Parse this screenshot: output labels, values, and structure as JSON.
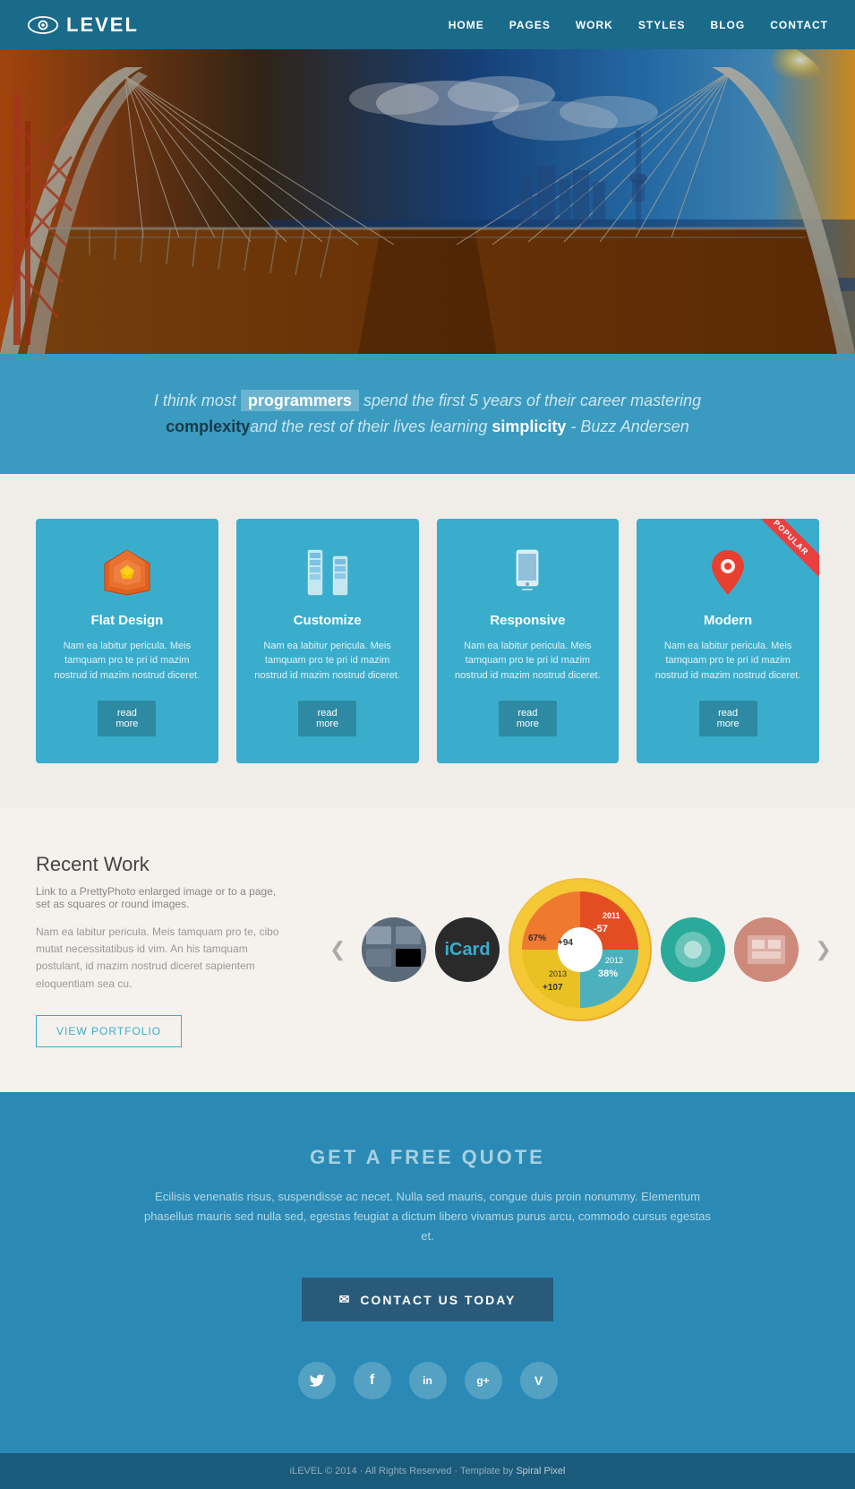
{
  "nav": {
    "logo_text": "LEVEL",
    "links": [
      "HOME",
      "PAGES",
      "WORK",
      "STYLES",
      "BLOG",
      "CONTACT"
    ]
  },
  "quote": {
    "line1_prefix": "I think most ",
    "line1_highlight": "programmers",
    "line1_suffix": " spend the first 5 years of their career mastering",
    "line2_prefix": "",
    "line2_bold_dark": "complexity",
    "line2_middle": "and the rest of their lives learning ",
    "line2_bold": "simplicity",
    "line2_suffix": " - Buzz Andersen"
  },
  "features": [
    {
      "id": "flat-design",
      "title": "Flat Design",
      "desc": "Nam ea labitur pericula. Meis tamquam pro te pri id mazim nostrud id mazim nostrud diceret.",
      "read_more": "read\nmore",
      "popular": false
    },
    {
      "id": "customize",
      "title": "Customize",
      "desc": "Nam ea labitur pericula. Meis tamquam pro te pri id mazim nostrud id mazim nostrud diceret.",
      "read_more": "read\nmore",
      "popular": false
    },
    {
      "id": "responsive",
      "title": "Responsive",
      "desc": "Nam ea labitur pericula. Meis tamquam pro te pri id mazim nostrud id mazim nostrud diceret.",
      "read_more": "read\nmore",
      "popular": false
    },
    {
      "id": "modern",
      "title": "Modern",
      "desc": "Nam ea labitur pericula. Meis tamquam pro te pri id mazim nostrud id mazim nostrud diceret.",
      "read_more": "read\nmore",
      "popular": true
    }
  ],
  "recent_work": {
    "title": "Recent Work",
    "subtitle": "Link to a PrettyPhoto enlarged image or to a page, set as squares or round images.",
    "desc": "Nam ea labitur pericula. Meis tamquam pro te, cibo mutat necessitatibus id vim. An his tamquam postulant, id mazim nostrud diceret sapientem eloquentiam sea cu.",
    "view_portfolio_label": "VIEW PORTFOLIO"
  },
  "cta": {
    "title": "GET A FREE QUOTE",
    "desc": "Ecilisis venenatis risus, suspendisse ac necet. Nulla sed mauris, congue duis proin nonummy. Elementum phasellus mauris sed nulla sed, egestas feugiat a dictum libero vivamus purus arcu, commodo cursus egestas et.",
    "button_label": "CONTACT US TODAY"
  },
  "social": {
    "icons": [
      {
        "name": "twitter",
        "symbol": "𝕋"
      },
      {
        "name": "facebook",
        "symbol": "f"
      },
      {
        "name": "linkedin",
        "symbol": "in"
      },
      {
        "name": "google-plus",
        "symbol": "g+"
      },
      {
        "name": "vimeo",
        "symbol": "V"
      }
    ]
  },
  "footer": {
    "text": "iLEVEL © 2014 · All Rights Reserved · Template by ",
    "brand": "Spiral Pixel"
  }
}
